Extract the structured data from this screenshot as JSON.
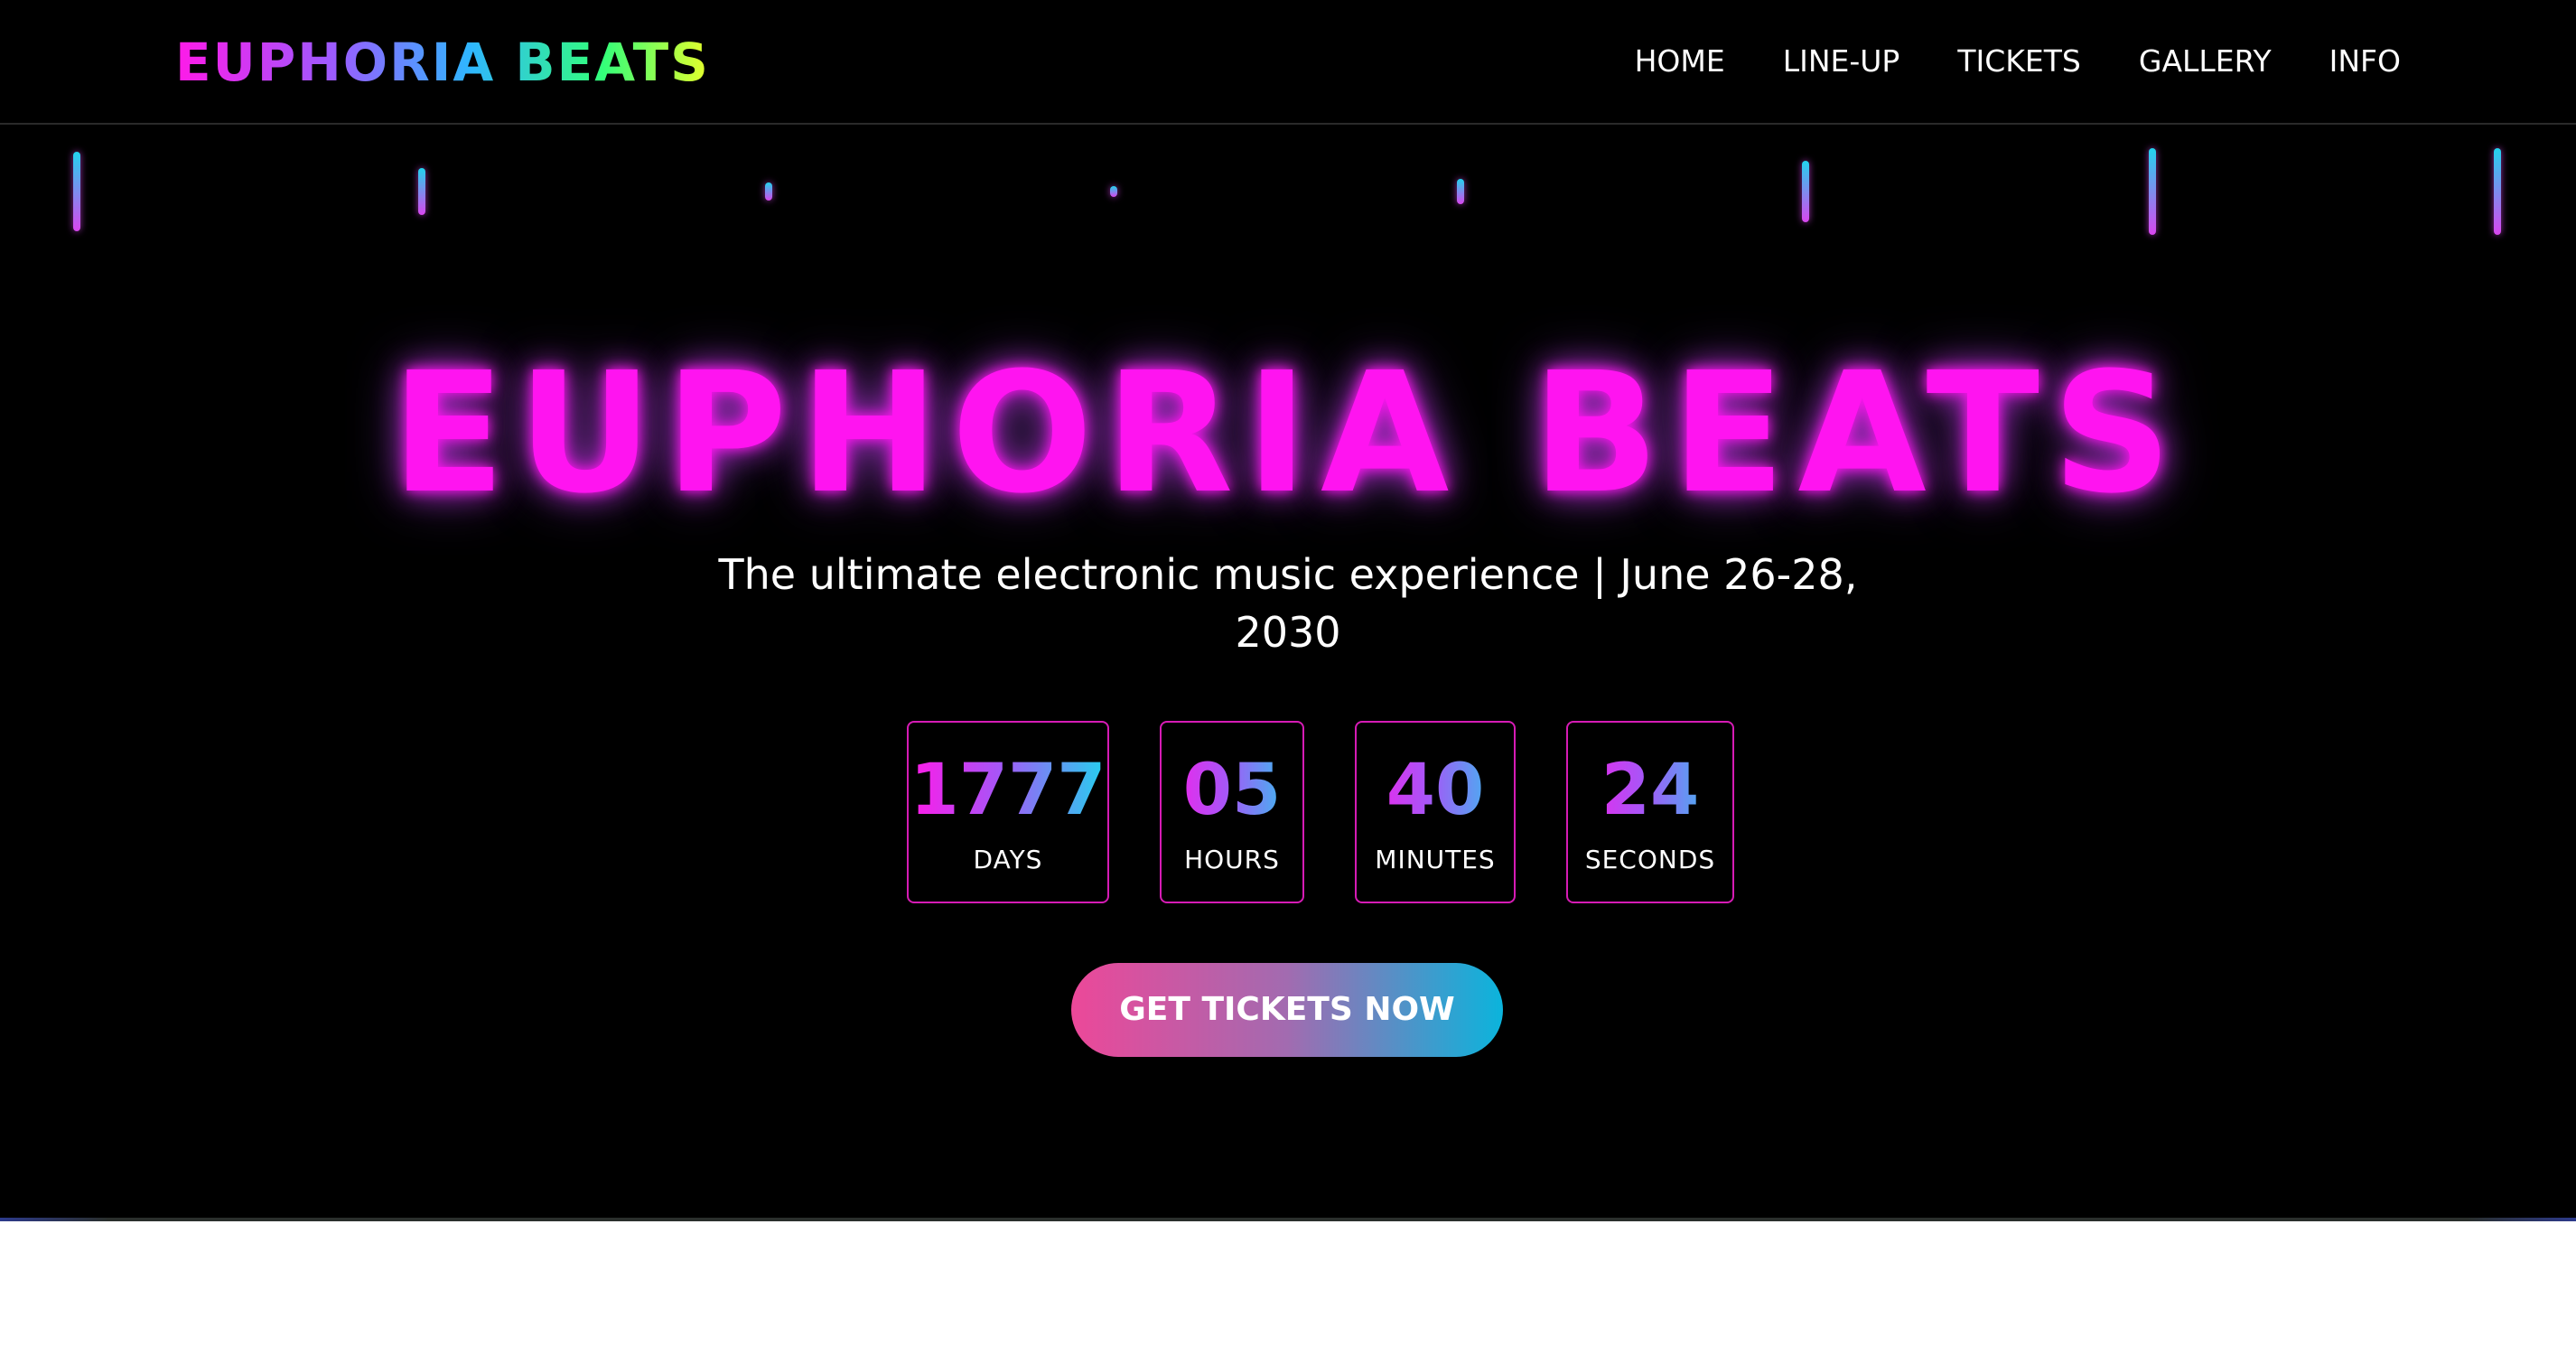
{
  "brand": {
    "logo": "EUPHORIA BEATS"
  },
  "nav": {
    "items": [
      {
        "label": "HOME"
      },
      {
        "label": "LINE-UP"
      },
      {
        "label": "TICKETS"
      },
      {
        "label": "GALLERY"
      },
      {
        "label": "INFO"
      }
    ]
  },
  "hero": {
    "title": "EUPHORIA BEATS",
    "subtitle": "The ultimate electronic music experience | June 26-28, 2030",
    "cta_label": "GET TICKETS NOW"
  },
  "countdown": [
    {
      "value": "1777",
      "unit": "DAYS"
    },
    {
      "value": "05",
      "unit": "HOURS"
    },
    {
      "value": "40",
      "unit": "MINUTES"
    },
    {
      "value": "24",
      "unit": "SECONDS"
    }
  ],
  "colors": {
    "background": "#000000",
    "accent_magenta": "#ff14f0",
    "accent_cyan": "#22d3ee",
    "box_border": "#d61bb5",
    "cta_start": "#ec4899",
    "cta_end": "#0bb4dc"
  }
}
